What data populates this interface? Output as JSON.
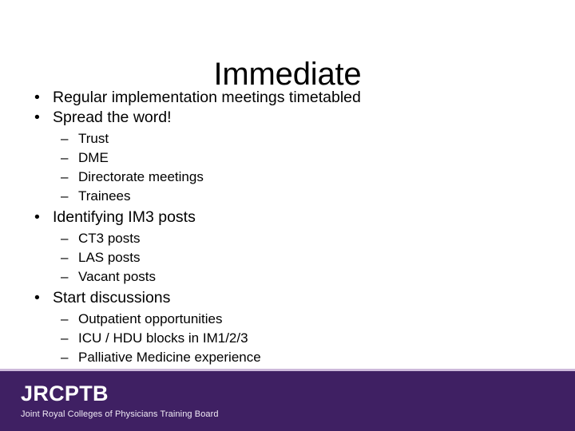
{
  "slide": {
    "title": "Immediate",
    "background_color": "#ffffff",
    "text_color": "#000000",
    "bullet_marker": "•",
    "sub_bullet_marker": "–",
    "content": [
      {
        "level": 1,
        "text": "Regular implementation meetings timetabled"
      },
      {
        "level": 1,
        "text": "Spread the word!"
      },
      {
        "level": 2,
        "text": "Trust"
      },
      {
        "level": 2,
        "text": "DME"
      },
      {
        "level": 2,
        "text": "Directorate meetings"
      },
      {
        "level": 2,
        "text": "Trainees"
      },
      {
        "level": 1,
        "text": "Identifying IM3 posts"
      },
      {
        "level": 2,
        "text": "CT3 posts"
      },
      {
        "level": 2,
        "text": "LAS posts"
      },
      {
        "level": 2,
        "text": "Vacant posts"
      },
      {
        "level": 1,
        "text": "Start discussions"
      },
      {
        "level": 2,
        "text": "Outpatient opportunities"
      },
      {
        "level": 2,
        "text": "ICU / HDU blocks in IM1/2/3"
      },
      {
        "level": 2,
        "text": "Palliative Medicine experience"
      }
    ]
  },
  "footer": {
    "accent_stripe_color": "#cdb9db",
    "background_color": "#3f2063",
    "logo_mark": "JRCPTB",
    "logo_subtitle": "Joint Royal Colleges of Physicians Training Board"
  }
}
